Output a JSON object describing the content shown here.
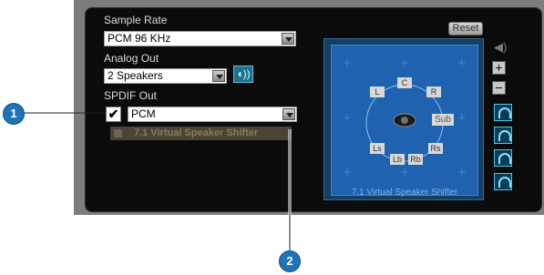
{
  "sample_rate": {
    "label": "Sample Rate",
    "value": "PCM 96 KHz"
  },
  "analog_out": {
    "label": "Analog Out",
    "value": "2 Speakers"
  },
  "spdif_out": {
    "label": "SPDIF Out",
    "value": "PCM",
    "checked": true
  },
  "shifter": {
    "label": "7.1 Virtual Speaker Shifter"
  },
  "reset_label": "Reset",
  "speakers": {
    "L": "L",
    "C": "C",
    "R": "R",
    "Sub": "Sub",
    "Ls": "Ls",
    "Rs": "Rs",
    "Lb": "Lb",
    "Rb": "Rb"
  },
  "visual_caption": "7.1 Virtual Speaker Shifter",
  "callouts": {
    "one": "1",
    "two": "2"
  },
  "colors": {
    "panel": "#0b0b0b",
    "accent": "#1d74b8",
    "visual": "#1f62b0",
    "teal": "#4fc3e8"
  },
  "icons": [
    "mute-speaker-icon",
    "plus-icon",
    "minus-icon",
    "speaker-test-icon"
  ]
}
